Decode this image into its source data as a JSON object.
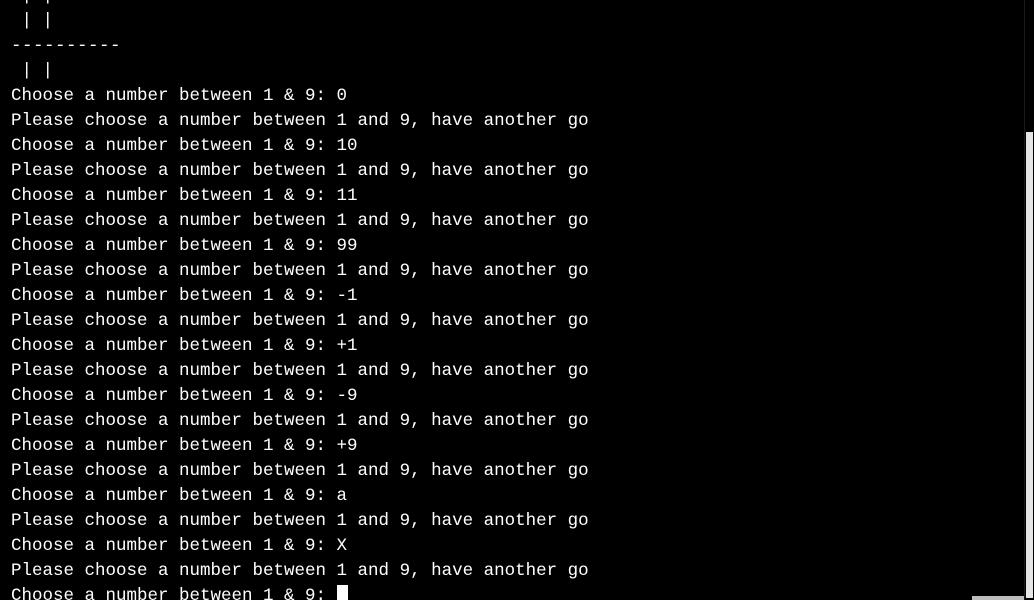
{
  "terminal": {
    "lines": [
      {
        "text": " | |",
        "kind": "board"
      },
      {
        "text": " | |",
        "kind": "board"
      },
      {
        "text": "----------",
        "kind": "board-divider"
      },
      {
        "text": " | |",
        "kind": "board"
      },
      {
        "text": "Choose a number between 1 & 9: 0",
        "kind": "prompt"
      },
      {
        "text": "Please choose a number between 1 and 9, have another go",
        "kind": "error"
      },
      {
        "text": "Choose a number between 1 & 9: 10",
        "kind": "prompt"
      },
      {
        "text": "Please choose a number between 1 and 9, have another go",
        "kind": "error"
      },
      {
        "text": "Choose a number between 1 & 9: 11",
        "kind": "prompt"
      },
      {
        "text": "Please choose a number between 1 and 9, have another go",
        "kind": "error"
      },
      {
        "text": "Choose a number between 1 & 9: 99",
        "kind": "prompt"
      },
      {
        "text": "Please choose a number between 1 and 9, have another go",
        "kind": "error"
      },
      {
        "text": "Choose a number between 1 & 9: -1",
        "kind": "prompt"
      },
      {
        "text": "Please choose a number between 1 and 9, have another go",
        "kind": "error"
      },
      {
        "text": "Choose a number between 1 & 9: +1",
        "kind": "prompt"
      },
      {
        "text": "Please choose a number between 1 and 9, have another go",
        "kind": "error"
      },
      {
        "text": "Choose a number between 1 & 9: -9",
        "kind": "prompt"
      },
      {
        "text": "Please choose a number between 1 and 9, have another go",
        "kind": "error"
      },
      {
        "text": "Choose a number between 1 & 9: +9",
        "kind": "prompt"
      },
      {
        "text": "Please choose a number between 1 and 9, have another go",
        "kind": "error"
      },
      {
        "text": "Choose a number between 1 & 9: a",
        "kind": "prompt"
      },
      {
        "text": "Please choose a number between 1 and 9, have another go",
        "kind": "error"
      },
      {
        "text": "Choose a number between 1 & 9: X",
        "kind": "prompt"
      },
      {
        "text": "Please choose a number between 1 and 9, have another go",
        "kind": "error"
      }
    ],
    "active_prompt": "Choose a number between 1 & 9: ",
    "colors": {
      "background": "#000000",
      "foreground": "#ffffff",
      "scrollbar_thumb": "#e6e6e6"
    }
  }
}
